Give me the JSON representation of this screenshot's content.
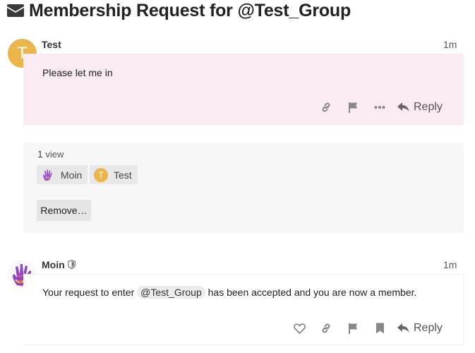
{
  "topic": {
    "title": "Membership Request for @Test_Group",
    "icon": "envelope-icon"
  },
  "post1": {
    "username": "Test",
    "avatar_letter": "T",
    "avatar_color": "#ecb54a",
    "date": "1m",
    "text": "Please let me in",
    "background": "#f9eaf4",
    "actions": [
      "link-icon",
      "flag-icon",
      "more-icon"
    ],
    "reply_label": "Reply"
  },
  "views": {
    "count": "1",
    "label": "view",
    "viewers": [
      {
        "name": "Moin",
        "avatar": "hand-avatar"
      },
      {
        "name": "Test",
        "avatar_letter": "T"
      }
    ],
    "remove_label": "Remove…"
  },
  "post2": {
    "username": "Moin",
    "badge": "shield-icon",
    "date": "1m",
    "text_before": "Your request to enter",
    "mention": "@Test_Group",
    "text_after": "has been accepted and you are now a member.",
    "actions": [
      "heart-icon",
      "link-icon",
      "flag-icon",
      "bookmark-icon"
    ],
    "reply_label": "Reply"
  }
}
